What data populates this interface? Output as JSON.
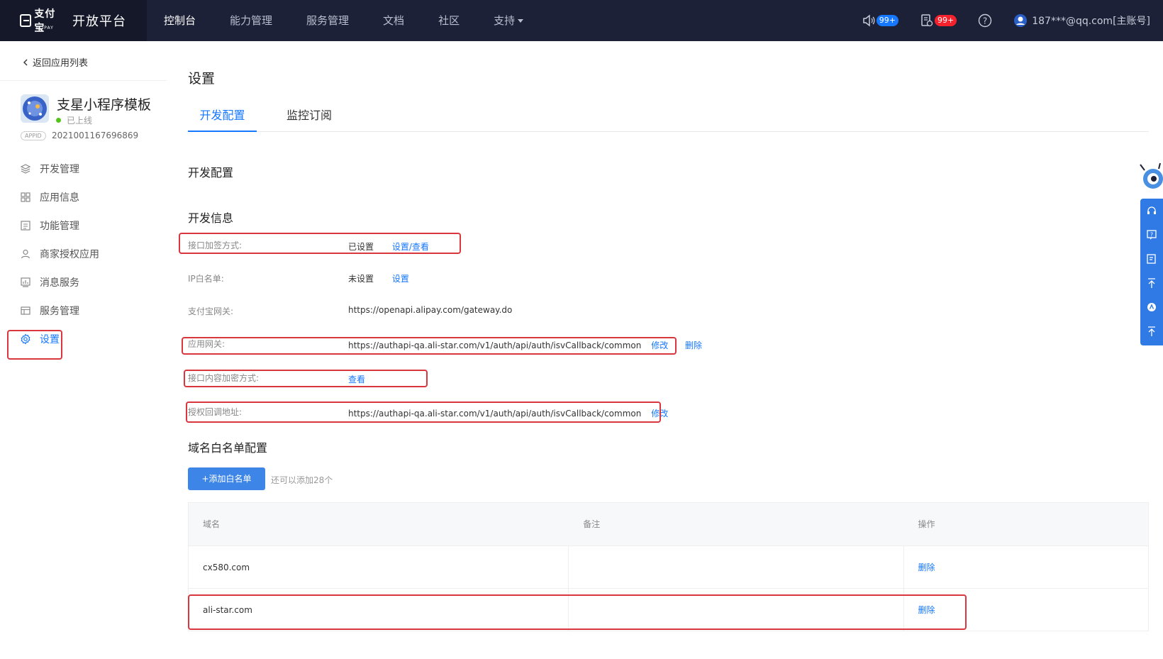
{
  "topbar": {
    "logo_cn": "支付宝",
    "logo_en": "ALIPAY",
    "platform": "开放平台",
    "nav": [
      {
        "label": "控制台"
      },
      {
        "label": "能力管理"
      },
      {
        "label": "服务管理"
      },
      {
        "label": "文档"
      },
      {
        "label": "社区"
      },
      {
        "label": "支持"
      }
    ],
    "notice_badge": "99+",
    "message_badge": "99+",
    "account": "187***@qq.com[主账号]"
  },
  "sidebar": {
    "back": "返回应用列表",
    "app_name": "支星小程序模板",
    "app_status": "已上线",
    "appid_tag": "APPID",
    "appid": "2021001167696869",
    "menu": [
      {
        "label": "开发管理",
        "icon": "layers-icon"
      },
      {
        "label": "应用信息",
        "icon": "grid-icon"
      },
      {
        "label": "功能管理",
        "icon": "list-icon"
      },
      {
        "label": "商家授权应用",
        "icon": "user-icon"
      },
      {
        "label": "消息服务",
        "icon": "chart-icon"
      },
      {
        "label": "服务管理",
        "icon": "table-icon"
      },
      {
        "label": "设置",
        "icon": "gear-icon"
      }
    ]
  },
  "main": {
    "page_title": "设置",
    "tabs": [
      {
        "label": "开发配置"
      },
      {
        "label": "监控订阅"
      }
    ],
    "section_dev_config": "开发配置",
    "section_dev_info": "开发信息",
    "rows": [
      {
        "label": "接口加签方式:",
        "value": "已设置",
        "link1": "设置/查看",
        "link2": ""
      },
      {
        "label": "IP白名单:",
        "value": "未设置",
        "link1": "设置",
        "link2": ""
      },
      {
        "label": "支付宝网关:",
        "value": "https://openapi.alipay.com/gateway.do",
        "link1": "",
        "link2": ""
      },
      {
        "label": "应用网关:",
        "value": "https://authapi-qa.ali-star.com/v1/auth/api/auth/isvCallback/common",
        "link1": "修改",
        "link2": "删除"
      },
      {
        "label": "接口内容加密方式:",
        "value": "",
        "link1": "查看",
        "link2": ""
      },
      {
        "label": "授权回调地址:",
        "value": "https://authapi-qa.ali-star.com/v1/auth/api/auth/isvCallback/common",
        "link1": "修改",
        "link2": ""
      }
    ],
    "section_domain": "域名白名单配置",
    "add_button": "+添加白名单",
    "remaining": "还可以添加28个",
    "table": {
      "headers": [
        "域名",
        "备注",
        "操作"
      ],
      "rows": [
        {
          "domain": "cx580.com",
          "note": "",
          "action": "删除"
        },
        {
          "domain": "ali-star.com",
          "note": "",
          "action": "删除"
        }
      ]
    }
  },
  "colors": {
    "topbar": "#1c2138",
    "accent": "#1677ff",
    "highlight": "#d9363e"
  }
}
